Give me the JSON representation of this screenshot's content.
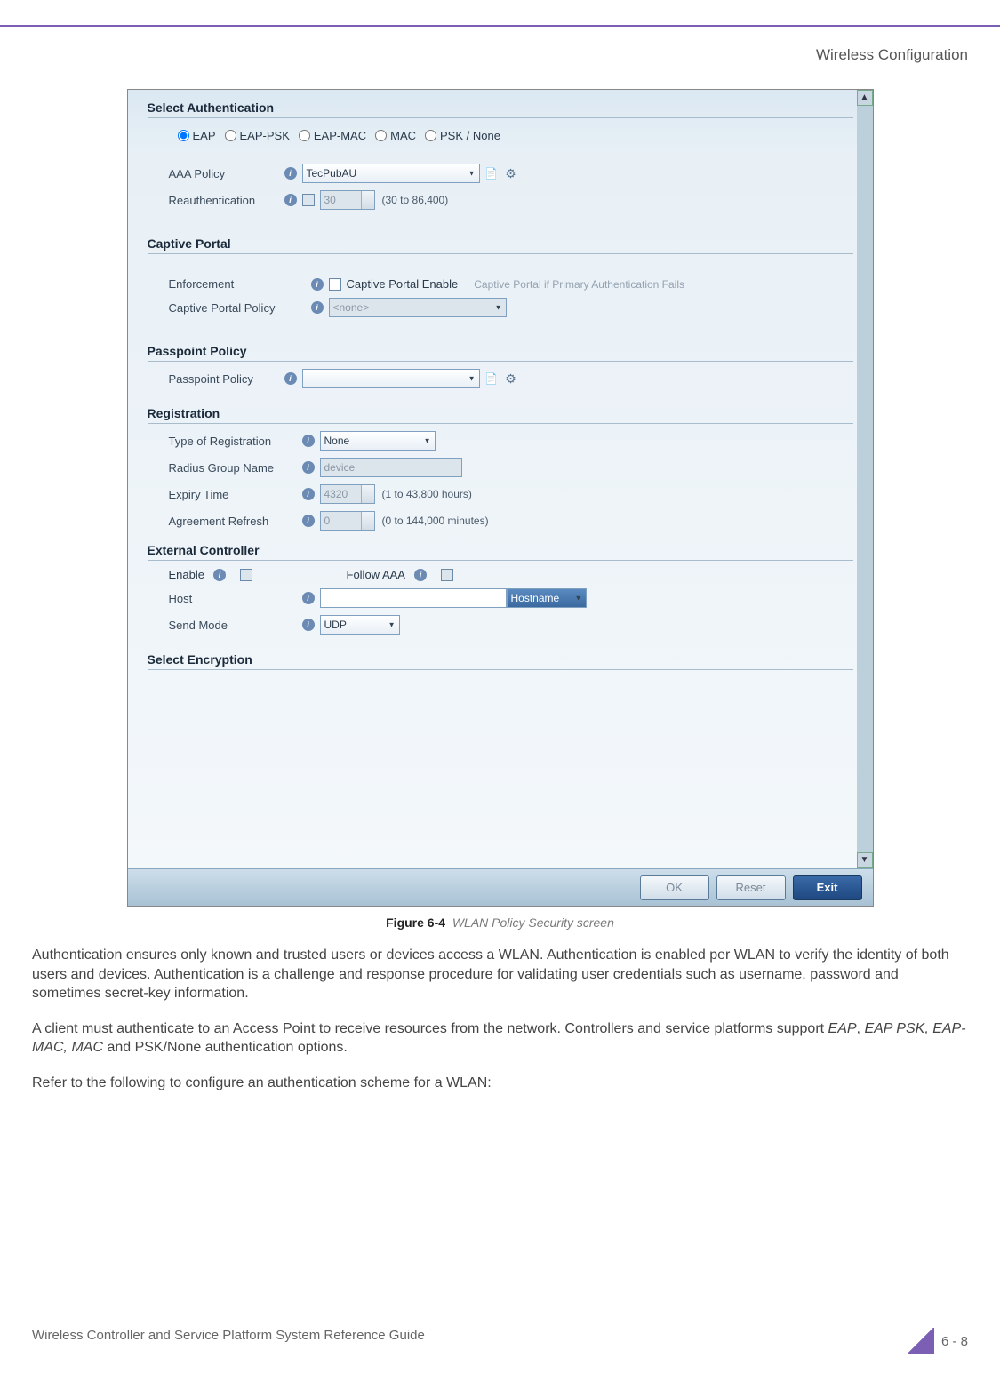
{
  "header": {
    "title": "Wireless Configuration"
  },
  "screenshot": {
    "auth_section": {
      "title": "Select Authentication",
      "radios": {
        "eap": "EAP",
        "eap_psk": "EAP-PSK",
        "eap_mac": "EAP-MAC",
        "mac": "MAC",
        "psk_none": "PSK / None"
      },
      "aaa_policy_label": "AAA Policy",
      "aaa_policy_value": "TecPubAU",
      "reauth_label": "Reauthentication",
      "reauth_value": "30",
      "reauth_hint": "(30 to 86,400)"
    },
    "captive_section": {
      "title": "Captive Portal",
      "enforcement_label": "Enforcement",
      "enable_label": "Captive Portal Enable",
      "fallback_label": "Captive Portal if Primary Authentication Fails",
      "policy_label": "Captive Portal Policy",
      "policy_value": "<none>"
    },
    "passpoint_section": {
      "title": "Passpoint Policy",
      "label": "Passpoint Policy",
      "value": ""
    },
    "registration_section": {
      "title": "Registration",
      "type_label": "Type of Registration",
      "type_value": "None",
      "group_label": "Radius Group Name",
      "group_value": "device",
      "expiry_label": "Expiry Time",
      "expiry_value": "4320",
      "expiry_hint": "(1 to 43,800 hours)",
      "refresh_label": "Agreement Refresh",
      "refresh_value": "0",
      "refresh_hint": "(0 to 144,000 minutes)"
    },
    "extctrl_section": {
      "title": "External Controller",
      "enable_label": "Enable",
      "follow_label": "Follow AAA",
      "host_label": "Host",
      "host_type": "Hostname",
      "sendmode_label": "Send Mode",
      "sendmode_value": "UDP"
    },
    "encryption_section": {
      "title": "Select Encryption"
    },
    "buttons": {
      "ok": "OK",
      "reset": "Reset",
      "exit": "Exit"
    }
  },
  "figure": {
    "number": "Figure 6-4",
    "caption": "WLAN Policy Security screen"
  },
  "paragraphs": {
    "p1": "Authentication ensures only known and trusted users or devices access a WLAN. Authentication is enabled per WLAN to verify the identity of both users and devices. Authentication is a challenge and response procedure for validating user credentials such as username, password and sometimes secret-key information.",
    "p2_a": "A client must authenticate to an Access Point to receive resources from the network. Controllers and service platforms support ",
    "p2_em": "EAP",
    "p2_b": ", ",
    "p2_em2": "EAP PSK, EAP-MAC, MAC",
    "p2_c": " and PSK/None authentication options.",
    "p3": "Refer to the following to configure an authentication scheme for a WLAN:"
  },
  "footer": {
    "text": "Wireless Controller and Service Platform System Reference Guide",
    "page": "6 - 8"
  }
}
